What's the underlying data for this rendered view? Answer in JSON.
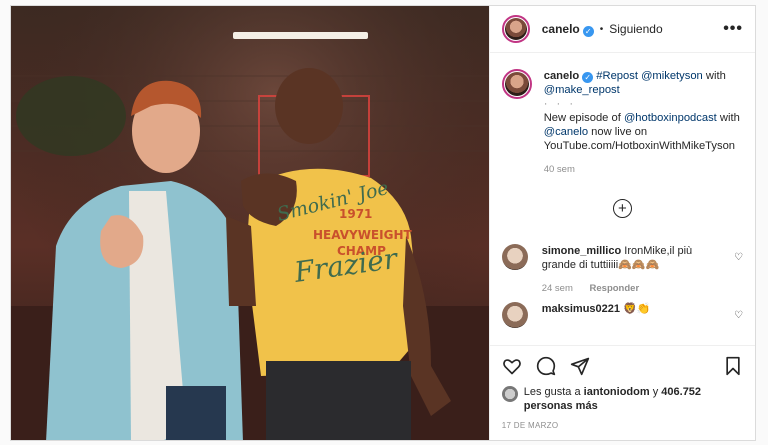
{
  "header": {
    "username": "canelo",
    "verified_mark": "✓",
    "separator": "•",
    "follow_status": "Siguiendo",
    "more_label": "•••"
  },
  "caption": {
    "username": "canelo",
    "repost_tag": "#Repost",
    "mention1": "@miketyson",
    "with1": "with",
    "mention2": "@make_repost",
    "dots": "· · ·",
    "line_prefix": "New episode of",
    "mention3": "@hotboxinpodcast",
    "with2": "with",
    "mention4": "@canelo",
    "line_suffix": "now live on YouTube.com/HotboxinWithMikeTyson",
    "time": "40 sem"
  },
  "load_more": "+",
  "comments": [
    {
      "username": "simone_millico",
      "text": "IronMike,il più grande di tuttiiiii🙈🙈🙈",
      "time": "24 sem",
      "reply": "Responder"
    },
    {
      "username": "maksimus0221",
      "text": "🦁👏",
      "time": "",
      "reply": ""
    }
  ],
  "likes": {
    "prefix": "Les gusta a",
    "user": "iantoniodom",
    "conj": "y",
    "count": "406.752 personas más"
  },
  "date": "17 DE MARZO",
  "photo": {
    "shirt_line1": "Smokin' Joe",
    "shirt_line2": "1971",
    "shirt_line3": "HEAVYWEIGHT",
    "shirt_line4": "CHAMP",
    "shirt_line5": "Frazier"
  },
  "colors": {
    "accent_blue": "#3897f0",
    "link": "#00376b",
    "muted": "#8e8e8e"
  }
}
